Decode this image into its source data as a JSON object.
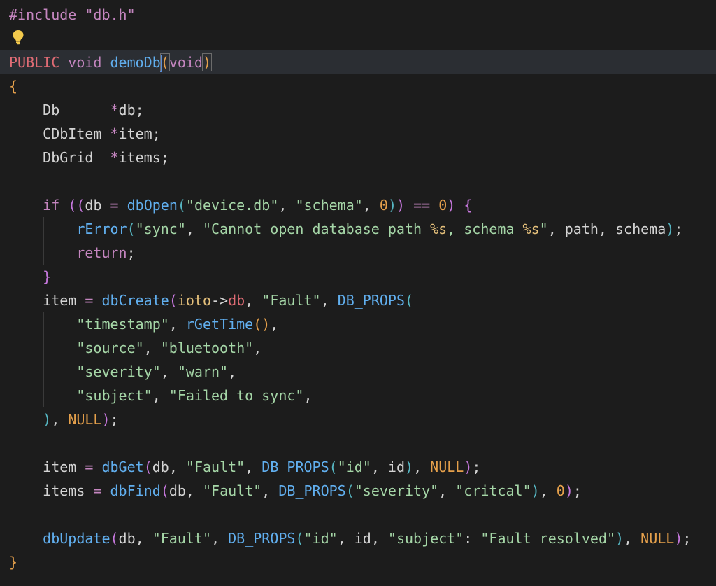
{
  "colors": {
    "background": "#1c1c1c",
    "current_line": "#2b2e33",
    "keyword_purple": "#c586c0",
    "function_blue": "#61afef",
    "string_green": "#a5d6a7",
    "number_orange": "#e5a04b",
    "type_red": "#e06c75",
    "default_text": "#d4d4d4",
    "brace_yellow": "#e5c07b",
    "bracket_purple": "#c678dd",
    "bracket_blue": "#56b6c2"
  },
  "icons": {
    "lightbulb": "lightbulb-icon"
  },
  "lines": [
    [
      {
        "t": "#include \"db.h\"",
        "c": "#c586c0"
      }
    ],
    [],
    [
      {
        "t": "PUBLIC",
        "c": "#e06c75"
      },
      {
        "t": " ",
        "c": "#d4d4d4"
      },
      {
        "t": "void",
        "c": "#c586c0"
      },
      {
        "t": " ",
        "c": "#d4d4d4"
      },
      {
        "t": "demoDb",
        "c": "#61afef"
      },
      {
        "cursor": true
      },
      {
        "t": "(",
        "c": "#e5a04b",
        "match": true
      },
      {
        "t": "void",
        "c": "#c586c0"
      },
      {
        "t": ")",
        "c": "#e5a04b",
        "match": true
      }
    ],
    [
      {
        "t": "{",
        "c": "#e5a04b"
      }
    ],
    [
      {
        "t": "    Db      ",
        "c": "#d4d4d4"
      },
      {
        "t": "*",
        "c": "#c586c0"
      },
      {
        "t": "db;",
        "c": "#d4d4d4"
      }
    ],
    [
      {
        "t": "    CDbItem ",
        "c": "#d4d4d4"
      },
      {
        "t": "*",
        "c": "#c586c0"
      },
      {
        "t": "item;",
        "c": "#d4d4d4"
      }
    ],
    [
      {
        "t": "    DbGrid  ",
        "c": "#d4d4d4"
      },
      {
        "t": "*",
        "c": "#c586c0"
      },
      {
        "t": "items;",
        "c": "#d4d4d4"
      }
    ],
    [],
    [
      {
        "t": "    ",
        "c": "#d4d4d4"
      },
      {
        "t": "if",
        "c": "#c586c0"
      },
      {
        "t": " ",
        "c": "#d4d4d4"
      },
      {
        "t": "((",
        "c": "#c678dd"
      },
      {
        "t": "db ",
        "c": "#d4d4d4"
      },
      {
        "t": "=",
        "c": "#c586c0"
      },
      {
        "t": " ",
        "c": "#d4d4d4"
      },
      {
        "t": "dbOpen",
        "c": "#61afef"
      },
      {
        "t": "(",
        "c": "#56b6c2"
      },
      {
        "t": "\"device.db\"",
        "c": "#a5d6a7"
      },
      {
        "t": ", ",
        "c": "#d4d4d4"
      },
      {
        "t": "\"schema\"",
        "c": "#a5d6a7"
      },
      {
        "t": ", ",
        "c": "#d4d4d4"
      },
      {
        "t": "0",
        "c": "#e5a04b"
      },
      {
        "t": ")",
        "c": "#56b6c2"
      },
      {
        "t": ")",
        "c": "#c678dd"
      },
      {
        "t": " ",
        "c": "#d4d4d4"
      },
      {
        "t": "==",
        "c": "#c586c0"
      },
      {
        "t": " ",
        "c": "#d4d4d4"
      },
      {
        "t": "0",
        "c": "#e5a04b"
      },
      {
        "t": ")",
        "c": "#c678dd"
      },
      {
        "t": " ",
        "c": "#d4d4d4"
      },
      {
        "t": "{",
        "c": "#c678dd"
      }
    ],
    [
      {
        "t": "        ",
        "c": "#d4d4d4"
      },
      {
        "t": "rError",
        "c": "#61afef"
      },
      {
        "t": "(",
        "c": "#56b6c2"
      },
      {
        "t": "\"sync\"",
        "c": "#a5d6a7"
      },
      {
        "t": ", ",
        "c": "#d4d4d4"
      },
      {
        "t": "\"Cannot open database path ",
        "c": "#a5d6a7"
      },
      {
        "t": "%s",
        "c": "#e5c07b"
      },
      {
        "t": ", schema ",
        "c": "#a5d6a7"
      },
      {
        "t": "%s",
        "c": "#e5c07b"
      },
      {
        "t": "\"",
        "c": "#a5d6a7"
      },
      {
        "t": ", path, schema",
        "c": "#d4d4d4"
      },
      {
        "t": ")",
        "c": "#56b6c2"
      },
      {
        "t": ";",
        "c": "#d4d4d4"
      }
    ],
    [
      {
        "t": "        ",
        "c": "#d4d4d4"
      },
      {
        "t": "return",
        "c": "#c586c0"
      },
      {
        "t": ";",
        "c": "#d4d4d4"
      }
    ],
    [
      {
        "t": "    ",
        "c": "#d4d4d4"
      },
      {
        "t": "}",
        "c": "#c678dd"
      }
    ],
    [
      {
        "t": "    item ",
        "c": "#d4d4d4"
      },
      {
        "t": "=",
        "c": "#c586c0"
      },
      {
        "t": " ",
        "c": "#d4d4d4"
      },
      {
        "t": "dbCreate",
        "c": "#61afef"
      },
      {
        "t": "(",
        "c": "#c678dd"
      },
      {
        "t": "ioto",
        "c": "#e5c07b"
      },
      {
        "t": "->",
        "c": "#d4d4d4"
      },
      {
        "t": "db",
        "c": "#e06c75"
      },
      {
        "t": ", ",
        "c": "#d4d4d4"
      },
      {
        "t": "\"Fault\"",
        "c": "#a5d6a7"
      },
      {
        "t": ", ",
        "c": "#d4d4d4"
      },
      {
        "t": "DB_PROPS",
        "c": "#61afef"
      },
      {
        "t": "(",
        "c": "#56b6c2"
      }
    ],
    [
      {
        "t": "        ",
        "c": "#d4d4d4"
      },
      {
        "t": "\"timestamp\"",
        "c": "#a5d6a7"
      },
      {
        "t": ", ",
        "c": "#d4d4d4"
      },
      {
        "t": "rGetTime",
        "c": "#61afef"
      },
      {
        "t": "()",
        "c": "#e5a04b"
      },
      {
        "t": ",",
        "c": "#d4d4d4"
      }
    ],
    [
      {
        "t": "        ",
        "c": "#d4d4d4"
      },
      {
        "t": "\"source\"",
        "c": "#a5d6a7"
      },
      {
        "t": ", ",
        "c": "#d4d4d4"
      },
      {
        "t": "\"bluetooth\"",
        "c": "#a5d6a7"
      },
      {
        "t": ",",
        "c": "#d4d4d4"
      }
    ],
    [
      {
        "t": "        ",
        "c": "#d4d4d4"
      },
      {
        "t": "\"severity\"",
        "c": "#a5d6a7"
      },
      {
        "t": ", ",
        "c": "#d4d4d4"
      },
      {
        "t": "\"warn\"",
        "c": "#a5d6a7"
      },
      {
        "t": ",",
        "c": "#d4d4d4"
      }
    ],
    [
      {
        "t": "        ",
        "c": "#d4d4d4"
      },
      {
        "t": "\"subject\"",
        "c": "#a5d6a7"
      },
      {
        "t": ", ",
        "c": "#d4d4d4"
      },
      {
        "t": "\"Failed to sync\"",
        "c": "#a5d6a7"
      },
      {
        "t": ",",
        "c": "#d4d4d4"
      }
    ],
    [
      {
        "t": "    ",
        "c": "#d4d4d4"
      },
      {
        "t": ")",
        "c": "#56b6c2"
      },
      {
        "t": ", ",
        "c": "#d4d4d4"
      },
      {
        "t": "NULL",
        "c": "#e5a04b"
      },
      {
        "t": ")",
        "c": "#c678dd"
      },
      {
        "t": ";",
        "c": "#d4d4d4"
      }
    ],
    [],
    [
      {
        "t": "    item ",
        "c": "#d4d4d4"
      },
      {
        "t": "=",
        "c": "#c586c0"
      },
      {
        "t": " ",
        "c": "#d4d4d4"
      },
      {
        "t": "dbGet",
        "c": "#61afef"
      },
      {
        "t": "(",
        "c": "#c678dd"
      },
      {
        "t": "db, ",
        "c": "#d4d4d4"
      },
      {
        "t": "\"Fault\"",
        "c": "#a5d6a7"
      },
      {
        "t": ", ",
        "c": "#d4d4d4"
      },
      {
        "t": "DB_PROPS",
        "c": "#61afef"
      },
      {
        "t": "(",
        "c": "#56b6c2"
      },
      {
        "t": "\"id\"",
        "c": "#a5d6a7"
      },
      {
        "t": ", id",
        "c": "#d4d4d4"
      },
      {
        "t": ")",
        "c": "#56b6c2"
      },
      {
        "t": ", ",
        "c": "#d4d4d4"
      },
      {
        "t": "NULL",
        "c": "#e5a04b"
      },
      {
        "t": ")",
        "c": "#c678dd"
      },
      {
        "t": ";",
        "c": "#d4d4d4"
      }
    ],
    [
      {
        "t": "    items ",
        "c": "#d4d4d4"
      },
      {
        "t": "=",
        "c": "#c586c0"
      },
      {
        "t": " ",
        "c": "#d4d4d4"
      },
      {
        "t": "dbFind",
        "c": "#61afef"
      },
      {
        "t": "(",
        "c": "#c678dd"
      },
      {
        "t": "db, ",
        "c": "#d4d4d4"
      },
      {
        "t": "\"Fault\"",
        "c": "#a5d6a7"
      },
      {
        "t": ", ",
        "c": "#d4d4d4"
      },
      {
        "t": "DB_PROPS",
        "c": "#61afef"
      },
      {
        "t": "(",
        "c": "#56b6c2"
      },
      {
        "t": "\"severity\"",
        "c": "#a5d6a7"
      },
      {
        "t": ", ",
        "c": "#d4d4d4"
      },
      {
        "t": "\"critcal\"",
        "c": "#a5d6a7"
      },
      {
        "t": ")",
        "c": "#56b6c2"
      },
      {
        "t": ", ",
        "c": "#d4d4d4"
      },
      {
        "t": "0",
        "c": "#e5a04b"
      },
      {
        "t": ")",
        "c": "#c678dd"
      },
      {
        "t": ";",
        "c": "#d4d4d4"
      }
    ],
    [],
    [
      {
        "t": "    ",
        "c": "#d4d4d4"
      },
      {
        "t": "dbUpdate",
        "c": "#61afef"
      },
      {
        "t": "(",
        "c": "#c678dd"
      },
      {
        "t": "db, ",
        "c": "#d4d4d4"
      },
      {
        "t": "\"Fault\"",
        "c": "#a5d6a7"
      },
      {
        "t": ", ",
        "c": "#d4d4d4"
      },
      {
        "t": "DB_PROPS",
        "c": "#61afef"
      },
      {
        "t": "(",
        "c": "#56b6c2"
      },
      {
        "t": "\"id\"",
        "c": "#a5d6a7"
      },
      {
        "t": ", id, ",
        "c": "#d4d4d4"
      },
      {
        "t": "\"subject\"",
        "c": "#a5d6a7"
      },
      {
        "t": ": ",
        "c": "#d4d4d4"
      },
      {
        "t": "\"Fault resolved\"",
        "c": "#a5d6a7"
      },
      {
        "t": ")",
        "c": "#56b6c2"
      },
      {
        "t": ", ",
        "c": "#d4d4d4"
      },
      {
        "t": "NULL",
        "c": "#e5a04b"
      },
      {
        "t": ")",
        "c": "#c678dd"
      },
      {
        "t": ";",
        "c": "#d4d4d4"
      }
    ],
    [
      {
        "t": "}",
        "c": "#e5a04b"
      }
    ]
  ]
}
